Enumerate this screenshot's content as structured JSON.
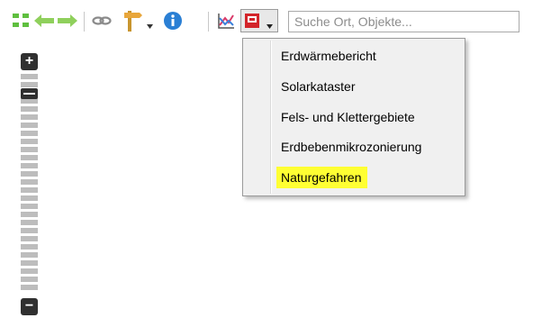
{
  "toolbar": {
    "search_placeholder": "Suche Ort, Objekte...",
    "icons": [
      "grid-icon",
      "back-arrow-icon",
      "forward-arrow-icon",
      "link-icon",
      "signpost-icon",
      "dropdown-arrow-icon",
      "info-icon",
      "chart-icon",
      "pdf-icon"
    ]
  },
  "menu": {
    "items": [
      {
        "label": "Erdwärmebericht",
        "highlighted": false
      },
      {
        "label": "Solarkataster",
        "highlighted": false
      },
      {
        "label": "Fels- und Klettergebiete",
        "highlighted": false
      },
      {
        "label": "Erdbebenmikrozonierung",
        "highlighted": false
      },
      {
        "label": "Naturgefahren",
        "highlighted": true
      }
    ]
  },
  "zoom": {
    "plus": "+",
    "minus": "−",
    "level_fraction": 0.07
  },
  "colors": {
    "accent_green": "#5fbf3f",
    "info_blue": "#2a7fd4",
    "highlight": "#ffff33",
    "pdf_red": "#d3242a"
  }
}
